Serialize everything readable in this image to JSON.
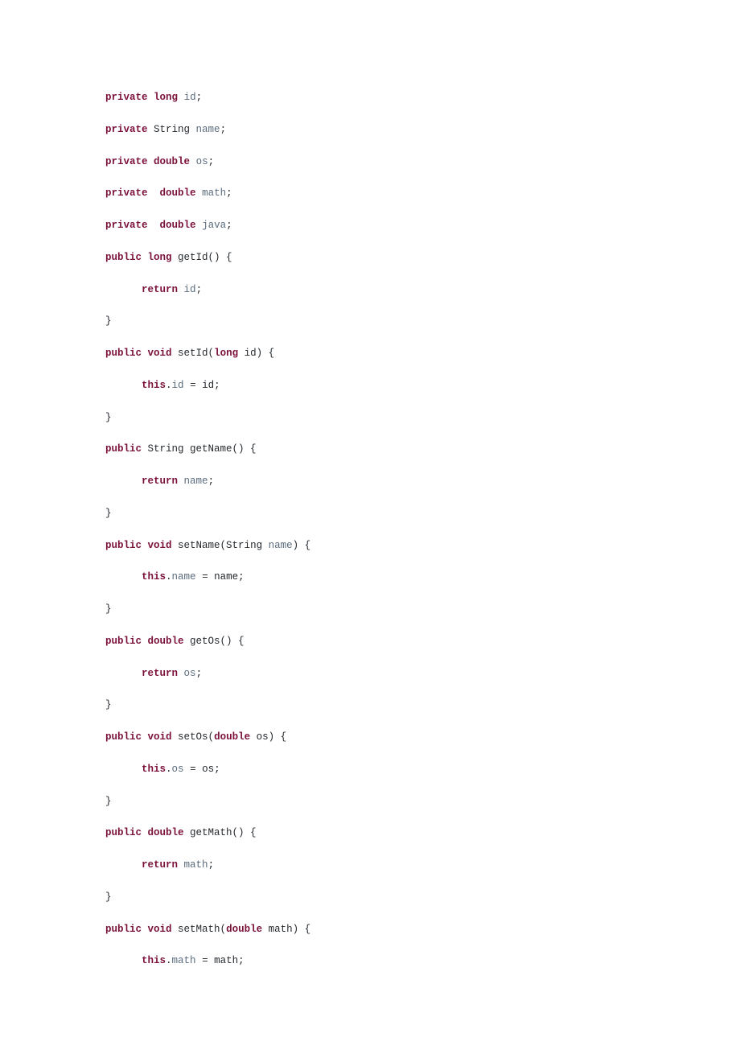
{
  "code": {
    "lines": [
      [
        {
          "t": "private",
          "c": "kw"
        },
        {
          "t": " ",
          "c": "pln"
        },
        {
          "t": "long",
          "c": "type"
        },
        {
          "t": " ",
          "c": "pln"
        },
        {
          "t": "id",
          "c": "id"
        },
        {
          "t": ";",
          "c": "pln"
        }
      ],
      [],
      [
        {
          "t": "private",
          "c": "kw"
        },
        {
          "t": " ",
          "c": "pln"
        },
        {
          "t": "String ",
          "c": "cls"
        },
        {
          "t": "name",
          "c": "id"
        },
        {
          "t": ";",
          "c": "pln"
        }
      ],
      [],
      [
        {
          "t": "private",
          "c": "kw"
        },
        {
          "t": " ",
          "c": "pln"
        },
        {
          "t": "double",
          "c": "type"
        },
        {
          "t": " ",
          "c": "pln"
        },
        {
          "t": "os",
          "c": "id"
        },
        {
          "t": ";",
          "c": "pln"
        }
      ],
      [],
      [
        {
          "t": "private",
          "c": "kw"
        },
        {
          "t": "  ",
          "c": "pln"
        },
        {
          "t": "double",
          "c": "type"
        },
        {
          "t": " ",
          "c": "pln"
        },
        {
          "t": "math",
          "c": "id"
        },
        {
          "t": ";",
          "c": "pln"
        }
      ],
      [],
      [
        {
          "t": "private",
          "c": "kw"
        },
        {
          "t": "  ",
          "c": "pln"
        },
        {
          "t": "double",
          "c": "type"
        },
        {
          "t": " ",
          "c": "pln"
        },
        {
          "t": "java",
          "c": "id"
        },
        {
          "t": ";",
          "c": "pln"
        }
      ],
      [],
      [
        {
          "t": "public",
          "c": "kw"
        },
        {
          "t": " ",
          "c": "pln"
        },
        {
          "t": "long",
          "c": "type"
        },
        {
          "t": " getId() {",
          "c": "pln"
        }
      ],
      [],
      [
        {
          "t": "      ",
          "c": "pln"
        },
        {
          "t": "return",
          "c": "kw"
        },
        {
          "t": " ",
          "c": "pln"
        },
        {
          "t": "id",
          "c": "id"
        },
        {
          "t": ";",
          "c": "pln"
        }
      ],
      [],
      [
        {
          "t": "}",
          "c": "pln"
        }
      ],
      [],
      [
        {
          "t": "public",
          "c": "kw"
        },
        {
          "t": " ",
          "c": "pln"
        },
        {
          "t": "void",
          "c": "kw"
        },
        {
          "t": " setId(",
          "c": "pln"
        },
        {
          "t": "long",
          "c": "type"
        },
        {
          "t": " id) {",
          "c": "pln"
        }
      ],
      [],
      [
        {
          "t": "      ",
          "c": "pln"
        },
        {
          "t": "this",
          "c": "kw"
        },
        {
          "t": ".",
          "c": "pln"
        },
        {
          "t": "id",
          "c": "id"
        },
        {
          "t": " = id;",
          "c": "pln"
        }
      ],
      [],
      [
        {
          "t": "}",
          "c": "pln"
        }
      ],
      [],
      [
        {
          "t": "public",
          "c": "kw"
        },
        {
          "t": " String getName() {",
          "c": "pln"
        }
      ],
      [],
      [
        {
          "t": "      ",
          "c": "pln"
        },
        {
          "t": "return",
          "c": "kw"
        },
        {
          "t": " ",
          "c": "pln"
        },
        {
          "t": "name",
          "c": "id"
        },
        {
          "t": ";",
          "c": "pln"
        }
      ],
      [],
      [
        {
          "t": "}",
          "c": "pln"
        }
      ],
      [],
      [
        {
          "t": "public",
          "c": "kw"
        },
        {
          "t": " ",
          "c": "pln"
        },
        {
          "t": "void",
          "c": "kw"
        },
        {
          "t": " setName(String ",
          "c": "pln"
        },
        {
          "t": "name",
          "c": "id"
        },
        {
          "t": ") {",
          "c": "pln"
        }
      ],
      [],
      [
        {
          "t": "      ",
          "c": "pln"
        },
        {
          "t": "this",
          "c": "kw"
        },
        {
          "t": ".",
          "c": "pln"
        },
        {
          "t": "name",
          "c": "id"
        },
        {
          "t": " = name;",
          "c": "pln"
        }
      ],
      [],
      [
        {
          "t": "}",
          "c": "pln"
        }
      ],
      [],
      [
        {
          "t": "public",
          "c": "kw"
        },
        {
          "t": " ",
          "c": "pln"
        },
        {
          "t": "double",
          "c": "type"
        },
        {
          "t": " getOs() {",
          "c": "pln"
        }
      ],
      [],
      [
        {
          "t": "      ",
          "c": "pln"
        },
        {
          "t": "return",
          "c": "kw"
        },
        {
          "t": " ",
          "c": "pln"
        },
        {
          "t": "os",
          "c": "id"
        },
        {
          "t": ";",
          "c": "pln"
        }
      ],
      [],
      [
        {
          "t": "}",
          "c": "pln"
        }
      ],
      [],
      [
        {
          "t": "public",
          "c": "kw"
        },
        {
          "t": " ",
          "c": "pln"
        },
        {
          "t": "void",
          "c": "kw"
        },
        {
          "t": " setOs(",
          "c": "pln"
        },
        {
          "t": "double",
          "c": "type"
        },
        {
          "t": " os) {",
          "c": "pln"
        }
      ],
      [],
      [
        {
          "t": "      ",
          "c": "pln"
        },
        {
          "t": "this",
          "c": "kw"
        },
        {
          "t": ".",
          "c": "pln"
        },
        {
          "t": "os",
          "c": "id"
        },
        {
          "t": " = os;",
          "c": "pln"
        }
      ],
      [],
      [
        {
          "t": "}",
          "c": "pln"
        }
      ],
      [],
      [
        {
          "t": "public",
          "c": "kw"
        },
        {
          "t": " ",
          "c": "pln"
        },
        {
          "t": "double",
          "c": "type"
        },
        {
          "t": " getMath() {",
          "c": "pln"
        }
      ],
      [],
      [
        {
          "t": "      ",
          "c": "pln"
        },
        {
          "t": "return",
          "c": "kw"
        },
        {
          "t": " ",
          "c": "pln"
        },
        {
          "t": "math",
          "c": "id"
        },
        {
          "t": ";",
          "c": "pln"
        }
      ],
      [],
      [
        {
          "t": "}",
          "c": "pln"
        }
      ],
      [],
      [
        {
          "t": "public",
          "c": "kw"
        },
        {
          "t": " ",
          "c": "pln"
        },
        {
          "t": "void",
          "c": "kw"
        },
        {
          "t": " setMath(",
          "c": "pln"
        },
        {
          "t": "double",
          "c": "type"
        },
        {
          "t": " math) {",
          "c": "pln"
        }
      ],
      [],
      [
        {
          "t": "      ",
          "c": "pln"
        },
        {
          "t": "this",
          "c": "kw"
        },
        {
          "t": ".",
          "c": "pln"
        },
        {
          "t": "math",
          "c": "id"
        },
        {
          "t": " = math;",
          "c": "pln"
        }
      ]
    ]
  }
}
